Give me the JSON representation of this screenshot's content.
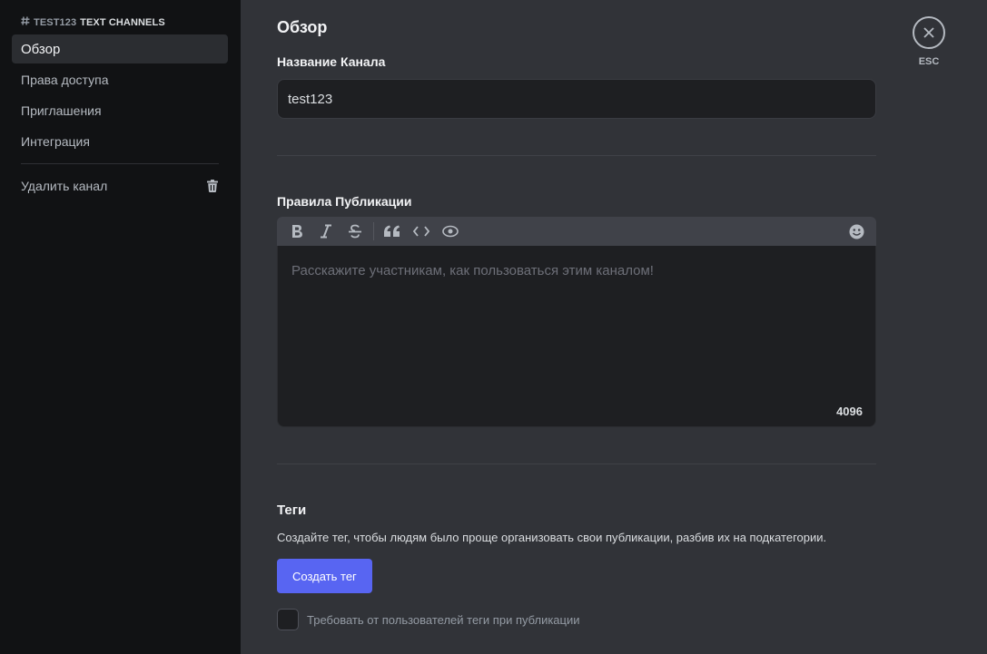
{
  "sidebar": {
    "server_name": "test123",
    "category": "TEXT CHANNELS",
    "items": [
      {
        "label": "Обзор",
        "active": true
      },
      {
        "label": "Права доступа"
      },
      {
        "label": "Приглашения"
      },
      {
        "label": "Интеграция"
      }
    ],
    "delete_label": "Удалить канал"
  },
  "main": {
    "title": "Обзор",
    "channel_name_label": "Название Канала",
    "channel_name_value": "test123",
    "guidelines_label": "Правила Публикации",
    "guidelines_placeholder": "Расскажите участникам, как пользоваться этим каналом!",
    "char_counter": "4096",
    "toolbar_icons": [
      "bold-icon",
      "italic-icon",
      "strikethrough-icon",
      "quote-icon",
      "code-icon",
      "eye-icon",
      "emoji-icon"
    ],
    "tags_title": "Теги",
    "tags_description": "Создайте тег, чтобы людям было проще организовать свои публикации, разбив их на подкатегории.",
    "create_tag_button": "Создать тег",
    "require_tags_label": "Требовать от пользователей теги при публикации"
  },
  "close": {
    "label": "ESC"
  },
  "colors": {
    "sidebar_bg": "#111214",
    "main_bg": "#313338",
    "input_bg": "#1e1f22",
    "accent": "#5865f2"
  }
}
